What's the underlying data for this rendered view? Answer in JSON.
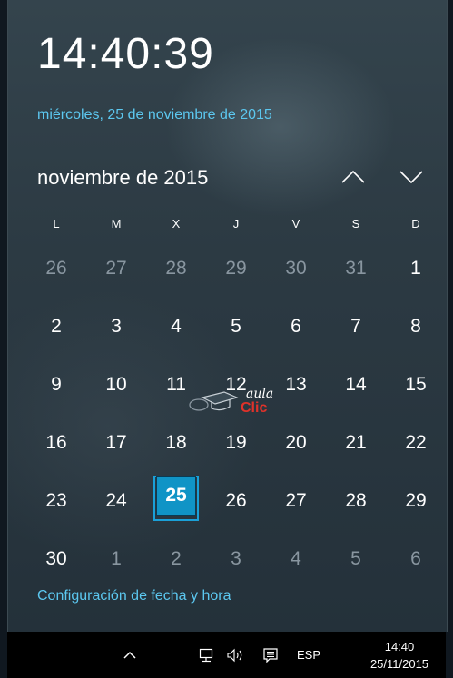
{
  "clock": {
    "time": "14:40:39",
    "long_date": "miércoles, 25 de noviembre de 2015"
  },
  "calendar": {
    "month_title": "noviembre de 2015",
    "weekdays": [
      "L",
      "M",
      "X",
      "J",
      "V",
      "S",
      "D"
    ],
    "weeks": [
      [
        "26",
        "27",
        "28",
        "29",
        "30",
        "31",
        "1"
      ],
      [
        "2",
        "3",
        "4",
        "5",
        "6",
        "7",
        "8"
      ],
      [
        "9",
        "10",
        "11",
        "12",
        "13",
        "14",
        "15"
      ],
      [
        "16",
        "17",
        "18",
        "19",
        "20",
        "21",
        "22"
      ],
      [
        "23",
        "24",
        "25",
        "26",
        "27",
        "28",
        "29"
      ],
      [
        "30",
        "1",
        "2",
        "3",
        "4",
        "5",
        "6"
      ]
    ],
    "selected_day": "25"
  },
  "settings_link": "Configuración de fecha y hora",
  "watermark": {
    "line1": "aula",
    "line2": "Clic"
  },
  "taskbar": {
    "language": "ESP",
    "time": "14:40",
    "date": "25/11/2015",
    "icons": [
      "chevron-up-icon",
      "network-icon",
      "volume-icon",
      "notification-icon"
    ]
  },
  "colors": {
    "accent": "#1094c6",
    "link": "#5cc8f0",
    "taskbar": "#000000"
  }
}
